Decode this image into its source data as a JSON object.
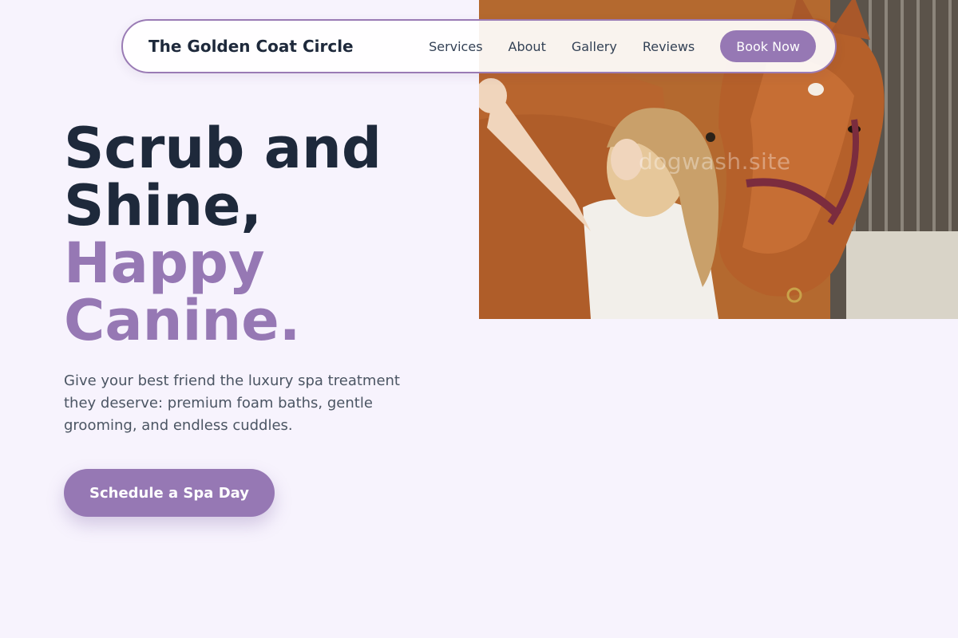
{
  "header": {
    "brand": "The Golden Coat Circle",
    "nav": [
      {
        "label": "Services"
      },
      {
        "label": "About"
      },
      {
        "label": "Gallery"
      },
      {
        "label": "Reviews"
      }
    ],
    "book_label": "Book Now"
  },
  "hero": {
    "headline_line1": "Scrub and",
    "headline_line2": "Shine,",
    "headline_accent1": "Happy",
    "headline_accent2": "Canine.",
    "subtext": "Give your best friend the luxury spa treatment they deserve: premium foam baths, gentle grooming, and endless cuddles.",
    "cta_label": "Schedule a Spa Day",
    "image_watermark": "dogwash.site"
  },
  "colors": {
    "accent": "#9678b4",
    "heading": "#1e293b",
    "background": "#f7f3fd"
  }
}
